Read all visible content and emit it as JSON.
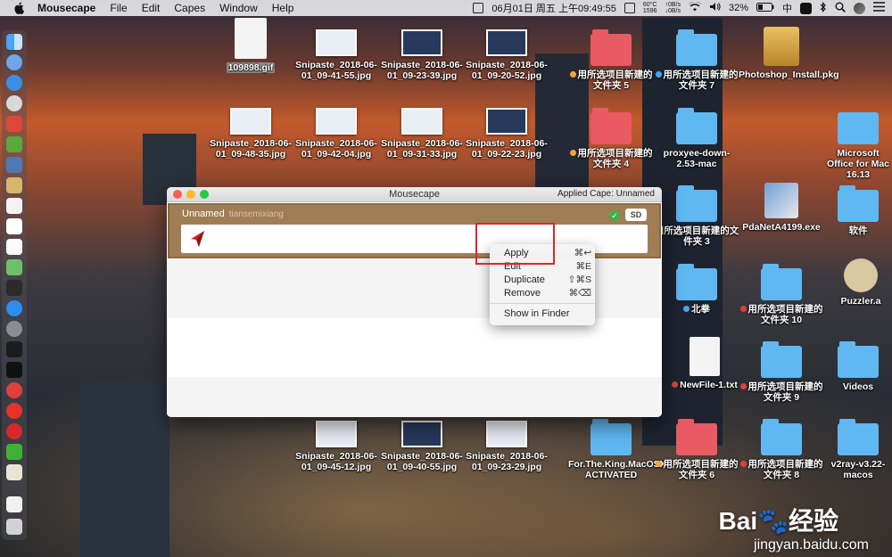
{
  "menubar": {
    "apple": "",
    "app_name": "Mousecape",
    "menus": [
      "File",
      "Edit",
      "Capes",
      "Window",
      "Help"
    ],
    "date_time": "06月01日 周五 上午09:49:55",
    "cpu_temp": "60°C",
    "fan": "1596",
    "net_up": "0B/s",
    "net_down": "0B/s",
    "battery": "32%",
    "input_lang": "中",
    "icons": [
      "calendar-icon",
      "screen-icon",
      "wifi-icon",
      "volume-icon",
      "bluetooth-icon",
      "search-icon",
      "siri-icon",
      "list-icon"
    ]
  },
  "desktop_icons": [
    {
      "label": "109898.gif",
      "type": "file"
    },
    {
      "label": "Snipaste_2018-06-01_09-41-55.jpg",
      "type": "thumb"
    },
    {
      "label": "Snipaste_2018-06-01_09-23-39.jpg",
      "type": "thumb"
    },
    {
      "label": "Snipaste_2018-06-01_09-20-52.jpg",
      "type": "thumb"
    },
    {
      "label": "用所选项目新建的文件夹 5",
      "type": "folder-red"
    },
    {
      "label": "用所选项目新建的文件夹 7",
      "type": "folder-blue"
    },
    {
      "label": "Photoshop_Install.pkg",
      "type": "pkg"
    },
    {
      "label": "Snipaste_2018-06-01_09-48-35.jpg",
      "type": "thumb"
    },
    {
      "label": "Snipaste_2018-06-01_09-42-04.jpg",
      "type": "thumb"
    },
    {
      "label": "Snipaste_2018-06-01_09-31-33.jpg",
      "type": "thumb"
    },
    {
      "label": "Snipaste_2018-06-01_09-22-23.jpg",
      "type": "thumb"
    },
    {
      "label": "用所选项目新建的文件夹 4",
      "type": "folder-red"
    },
    {
      "label": "proxyee-down-2.53-mac",
      "type": "folder-blue"
    },
    {
      "label": "Microsoft Office for Mac 16.13",
      "type": "folder-blue"
    },
    {
      "label": "用所选项目新建的文件夹 3",
      "type": "folder-blue"
    },
    {
      "label": "PdaNetA4199.exe",
      "type": "exe"
    },
    {
      "label": "软件",
      "type": "folder-blue"
    },
    {
      "label": "北拳",
      "type": "folder-blue"
    },
    {
      "label": "用所选项目新建的文件夹 10",
      "type": "folder-blue"
    },
    {
      "label": "Puzzler.a",
      "type": "app"
    },
    {
      "label": "NewFile-1.txt",
      "type": "txt"
    },
    {
      "label": "用所选项目新建的文件夹 9",
      "type": "folder-blue"
    },
    {
      "label": "Videos",
      "type": "folder-blue"
    },
    {
      "label": "Snipaste_2018-06-01_09-45-12.jpg",
      "type": "thumb"
    },
    {
      "label": "Snipaste_2018-06-01_09-40-55.jpg",
      "type": "thumb"
    },
    {
      "label": "Snipaste_2018-06-01_09-23-29.jpg",
      "type": "thumb"
    },
    {
      "label": "For.The.King.MacOSX-ACTIVATED",
      "type": "folder-blue"
    },
    {
      "label": "用所选项目新建的文件夹 6",
      "type": "folder-red"
    },
    {
      "label": "用所选项目新建的文件夹 8",
      "type": "folder-blue"
    },
    {
      "label": "v2ray-v3.22-macos",
      "type": "folder-blue"
    }
  ],
  "window": {
    "title": "Mousecape",
    "applied": "Applied Cape: Unnamed",
    "cape": {
      "name": "Unnamed",
      "author": "tiansemixiang",
      "badge": "SD",
      "check": "✓"
    }
  },
  "context_menu": {
    "items": [
      {
        "label": "Apply",
        "shortcut": "⌘↩"
      },
      {
        "label": "Edit",
        "shortcut": "⌘E"
      },
      {
        "label": "Duplicate",
        "shortcut": "⇧⌘S"
      },
      {
        "label": "Remove",
        "shortcut": "⌘⌫"
      },
      {
        "label": "Show in Finder",
        "shortcut": ""
      }
    ]
  },
  "watermark": {
    "brand": "Bai",
    "paw": "🐾",
    "suffix": "经验",
    "url": "jingyan.baidu.com"
  }
}
